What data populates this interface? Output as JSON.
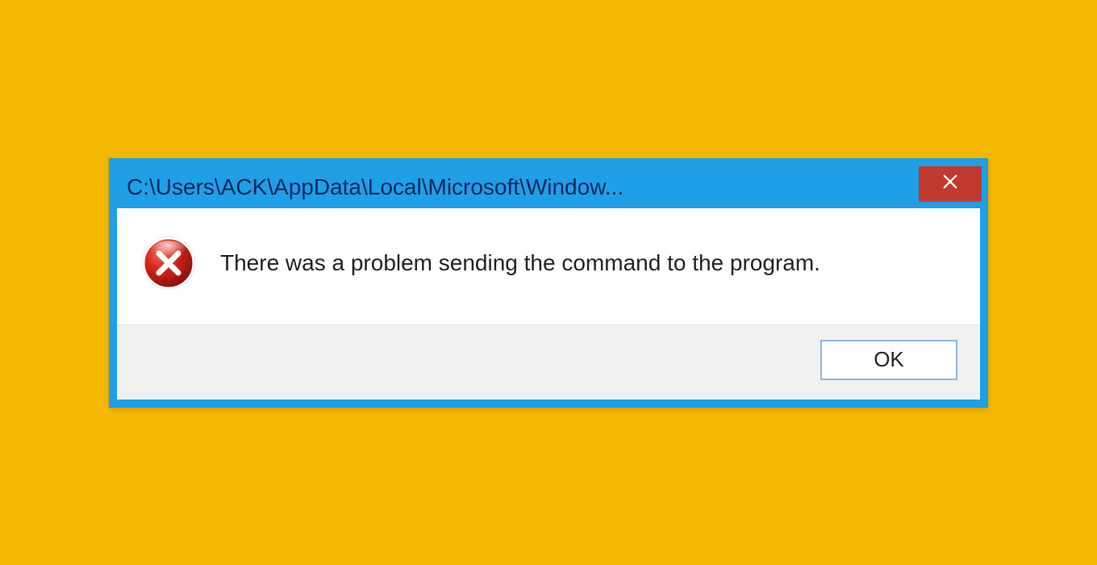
{
  "dialog": {
    "title": "C:\\Users\\ACK\\AppData\\Local\\Microsoft\\Window...",
    "message": "There was a problem sending the command to the program.",
    "ok_label": "OK",
    "icons": {
      "close": "close-icon",
      "error": "error-icon"
    },
    "colors": {
      "frame": "#1e9fe8",
      "close_button": "#c13a2f",
      "background": "#f5b800",
      "button_border": "#8db6dd"
    }
  }
}
